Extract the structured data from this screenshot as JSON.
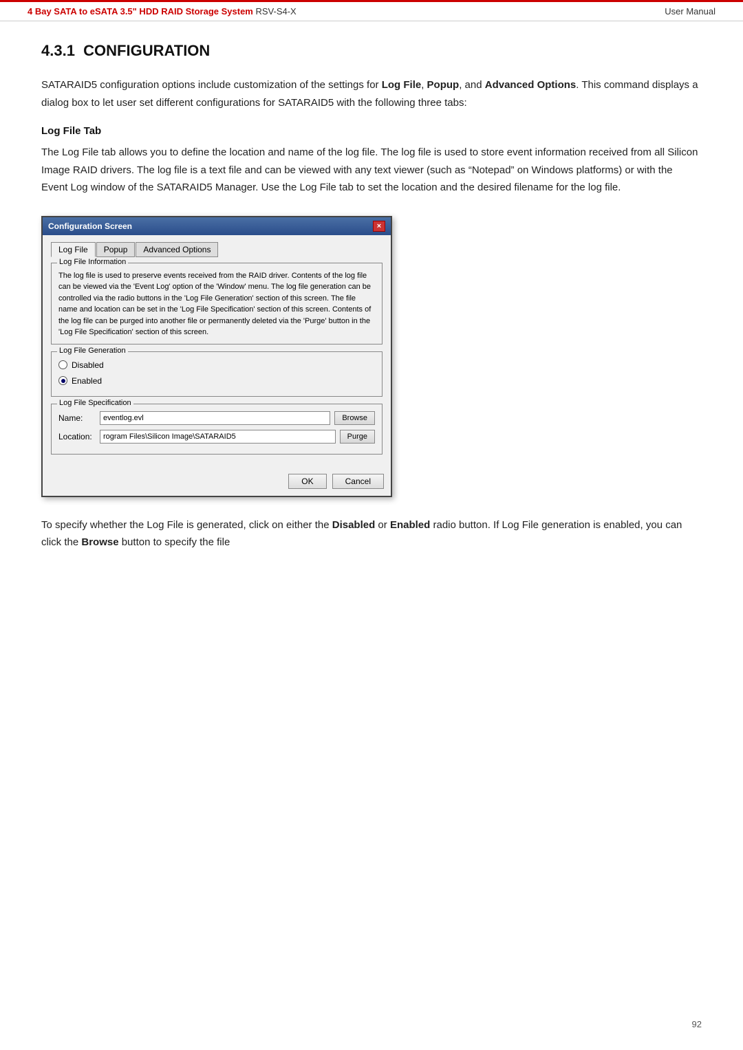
{
  "header": {
    "product_bold": "4 Bay SATA to eSATA 3.5\" HDD RAID Storage System",
    "product_model": " RSV-S4-X",
    "manual_label": "User Manual"
  },
  "section": {
    "number": "4.3.1",
    "title": "CONFIGURATION"
  },
  "intro_text": "SATARAID5 configuration options include customization of the settings for Log File, Popup, and Advanced Options.  This command displays a dialog box to let user set different configurations for SATARAID5 with the following three tabs:",
  "log_file_tab_heading": "Log File Tab",
  "log_file_tab_body": "The Log File tab allows you to define the location and name of the log file. The log file is used to store event information received from all Silicon Image RAID drivers. The log file is a text file and can be viewed with any text viewer (such as “Notepad” on Windows platforms) or with the Event Log window of the SATARAID5 Manager. Use the Log File tab to set the location and the desired filename for the log file.",
  "dialog": {
    "title": "Configuration Screen",
    "close_label": "×",
    "tabs": [
      {
        "label": "Log File",
        "active": true
      },
      {
        "label": "Popup",
        "active": false
      },
      {
        "label": "Advanced Options",
        "active": false
      }
    ],
    "log_info_group": {
      "title": "Log File Information",
      "text": "The log file is used to preserve events received from the RAID driver. Contents of the log file can be viewed via the 'Event Log' option of the 'Window' menu. The log file generation can be controlled via the radio buttons in the 'Log File Generation' section of this screen. The file name and location can be set  in  the  'Log File Specification' section of this screen.  Contents of the log file can be purged into another  file  or  permanently deleted via the 'Purge' button in the 'Log File Specification' section of this screen."
    },
    "log_generation_group": {
      "title": "Log File Generation",
      "options": [
        {
          "label": "Disabled",
          "selected": false
        },
        {
          "label": "Enabled",
          "selected": true
        }
      ]
    },
    "log_spec_group": {
      "title": "Log File Specification",
      "name_label": "Name:",
      "name_value": "eventlog.evl",
      "browse_label": "Browse",
      "location_label": "Location:",
      "location_value": "rogram Files\\Silicon Image\\SATARAID5",
      "purge_label": "Purge"
    },
    "ok_label": "OK",
    "cancel_label": "Cancel"
  },
  "footer_text": "To specify whether the Log File is generated, click on either the Disabled or Enabled radio button. If Log File generation is enabled, you can click the Browse button to specify the file",
  "page_number": "92"
}
